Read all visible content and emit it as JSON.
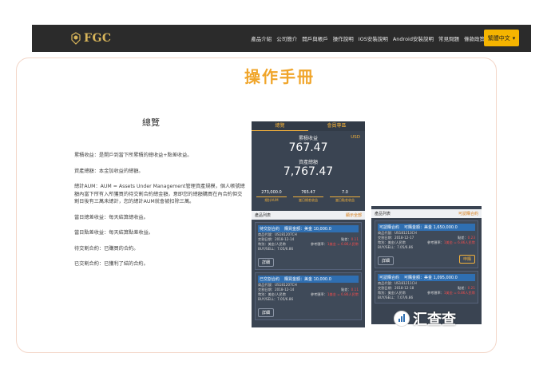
{
  "navbar": {
    "logo": "FGC",
    "items": [
      "產品介紹",
      "公司簡介",
      "開戶與帳戶",
      "操作說明",
      "IOS安裝說明",
      "Android安裝說明",
      "常見問題",
      "條款政策"
    ],
    "lang_button": "繁體中文"
  },
  "page": {
    "title": "操作手冊",
    "section_title": "總覽",
    "definitions": [
      "累積收益：是開戶到當下所累積的總收益+點差收益。",
      "資產總額：本金加收益的總額。",
      "總計AUM：AUM = Assets Under Management管理資產規模，個人帳號總額內當下所有入所獲買的待交割合約總金額，意即您的總額購買在內合約但交割日後有三萬未總計，您的總計AUM就會被扣除三萬。",
      "當日總差收益：每天結算總收益。",
      "當日點差收益：每天結算點差收益。",
      "待交割合約：已購買的合約。",
      "已交割合約：已獲利了結的合約。"
    ]
  },
  "phone1": {
    "tabs": [
      "總覽",
      "會員專區"
    ],
    "accum_label": "累積收益",
    "currency": "USD",
    "accum_value": "767.47",
    "asset_label": "資產總額",
    "asset_value": "7,767.47",
    "stats": [
      {
        "value": "273,000.0",
        "label": "總計AUM"
      },
      {
        "value": "765.47",
        "label": "當日總差收益"
      },
      {
        "value": "7.0",
        "label": "當日點差收益"
      }
    ],
    "list_label": "產品列表",
    "list_filter": "顯示全部",
    "cards": [
      {
        "status": "待交割合約",
        "amount": "購買金額：美金 10,000.0",
        "code": "商品代號：US181207CH",
        "date": "交割日期：2018-12-14",
        "currency": "幣別：美金/人民幣",
        "buysell": "BUY/SELL：7.05/6.86",
        "spread_label": "點差：",
        "spread": "0.11",
        "ref_label": "參考匯率：",
        "ref": "1美金 = 6.86人民幣",
        "detail": "詳細"
      },
      {
        "status": "已交割合約",
        "amount": "購買金額：美金 10,000.0",
        "code": "商品代號：US181207CH",
        "date": "交割日期：2018-12-14",
        "currency": "幣別：美金/人民幣",
        "buysell": "BUY/SELL：7.05/6.86",
        "spread_label": "點差：",
        "spread": "0.11",
        "ref_label": "參考匯率：",
        "ref": "1美金 = 6.86人民幣",
        "detail": "詳細"
      }
    ]
  },
  "phone2": {
    "list_label": "產品列表",
    "list_filter": "可認購合約",
    "cards": [
      {
        "status": "可認購合約",
        "amount": "可購金額：美金 1,650,000.0",
        "code": "商品代號：US181213CH",
        "date": "交割日期：2018-12-17",
        "currency": "幣別：美金/人民幣",
        "buysell": "BUY/SELL：7.05/6.86",
        "spread_label": "點差：",
        "spread": "0.23",
        "ref_label": "參考匯率：",
        "ref": "1美金 = 6.86人民幣",
        "detail": "詳細",
        "action": "申購"
      },
      {
        "status": "可認購合約",
        "amount": "可購金額：美金 1,095,000.0",
        "code": "商品代號：US181211CH",
        "date": "交割日期：2018-12-18",
        "currency": "幣別：美金/人民幣",
        "buysell": "BUY/SELL：7.07/6.86",
        "spread_label": "點差：",
        "spread": "0.21",
        "ref_label": "參考匯率：",
        "ref": "1美金 = 6.86人民幣",
        "detail": "詳細"
      }
    ]
  },
  "watermark": {
    "text": "汇查查"
  },
  "colors": {
    "accent": "#f0a52a",
    "navbar": "#2b2b2b",
    "lang_button": "#f5b400",
    "app_bg": "#3a4452"
  }
}
